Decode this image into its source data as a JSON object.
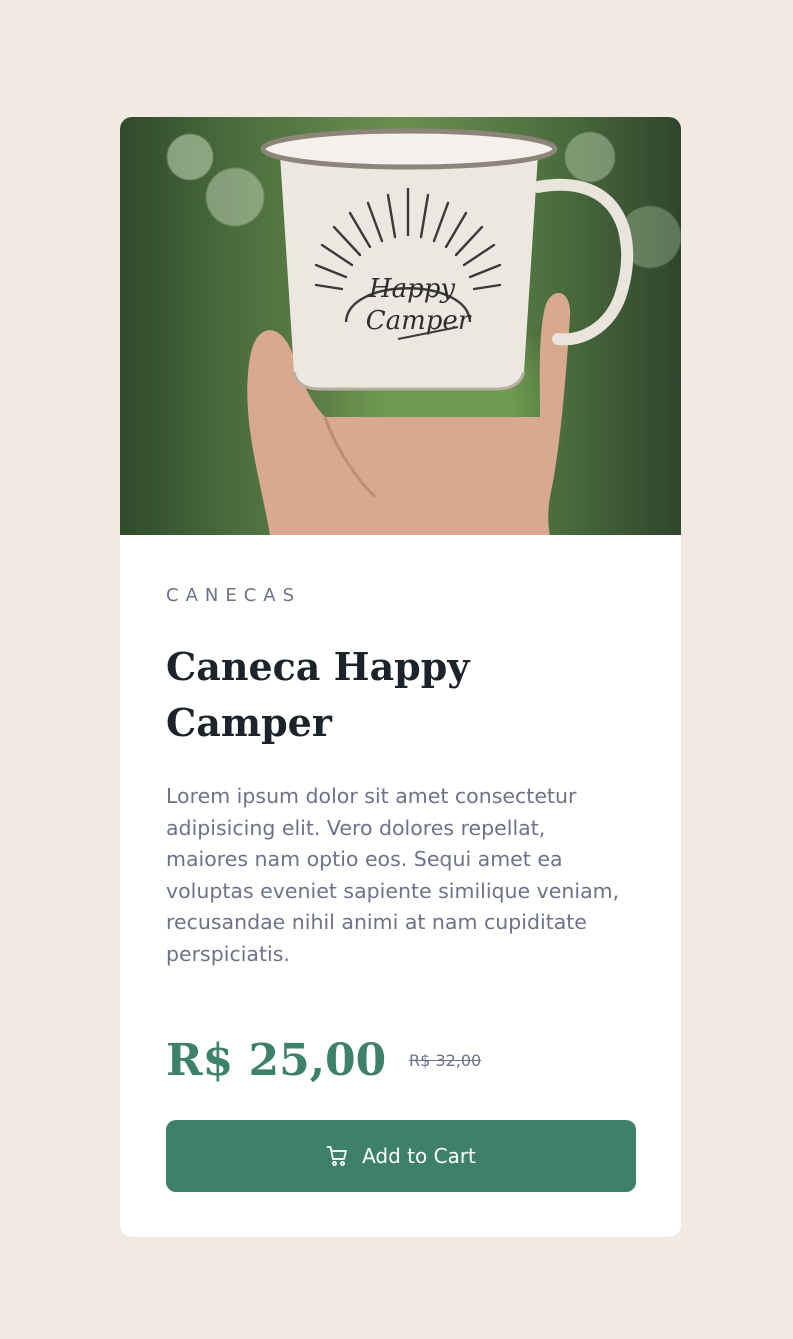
{
  "product": {
    "image_alt": "Hand holding a white enamel Happy Camper mug against a green forest background",
    "mug_text_line1": "Happy",
    "mug_text_line2": "Camper",
    "category": "CANECAS",
    "title": "Caneca Happy Camper",
    "description": "Lorem ipsum dolor sit amet consectetur adipisicing elit. Vero dolores repellat, maiores nam optio eos. Sequi amet ea voluptas eveniet sapiente similique veniam, recusandae nihil animi at nam cupiditate perspiciatis.",
    "price": "R$ 25,00",
    "old_price": "R$ 32,00",
    "cart_button_label": "Add to Cart",
    "cart_icon": "cart-icon"
  },
  "colors": {
    "page_background": "#F2EAE2",
    "card_background": "#FFFFFF",
    "accent": "#3D8168",
    "heading_text": "#1C232B",
    "body_text": "#6C7289"
  }
}
